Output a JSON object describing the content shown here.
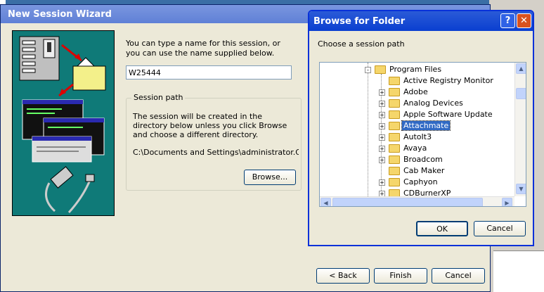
{
  "wizard": {
    "title": "New Session Wizard",
    "intro": "You can type a name for this session, or you can use the name supplied below.",
    "session_name": "W25444",
    "group_title": "Session path",
    "group_text": "The session will be created in the directory below unless you click Browse and choose a different directory.",
    "path": "C:\\Documents and Settings\\administrator.GTS-BF",
    "browse_label": "Browse...",
    "back_label": "< Back",
    "finish_label": "Finish",
    "cancel_label": "Cancel"
  },
  "browse_dialog": {
    "title": "Browse for Folder",
    "help_glyph": "?",
    "close_glyph": "✕",
    "prompt": "Choose a session path",
    "tree": [
      {
        "label": "Program Files",
        "level": 0,
        "expander": "-"
      },
      {
        "label": "Active Registry Monitor",
        "level": 1,
        "expander": ""
      },
      {
        "label": "Adobe",
        "level": 1,
        "expander": "+"
      },
      {
        "label": "Analog Devices",
        "level": 1,
        "expander": "+"
      },
      {
        "label": "Apple Software Update",
        "level": 1,
        "expander": "+"
      },
      {
        "label": "Attachmate",
        "level": 1,
        "expander": "+",
        "selected": true
      },
      {
        "label": "AutoIt3",
        "level": 1,
        "expander": "+"
      },
      {
        "label": "Avaya",
        "level": 1,
        "expander": "+"
      },
      {
        "label": "Broadcom",
        "level": 1,
        "expander": "+"
      },
      {
        "label": "Cab Maker",
        "level": 1,
        "expander": ""
      },
      {
        "label": "Caphyon",
        "level": 1,
        "expander": "+"
      },
      {
        "label": "CDBurnerXP",
        "level": 1,
        "expander": "+"
      }
    ],
    "ok_label": "OK",
    "cancel_label": "Cancel"
  }
}
